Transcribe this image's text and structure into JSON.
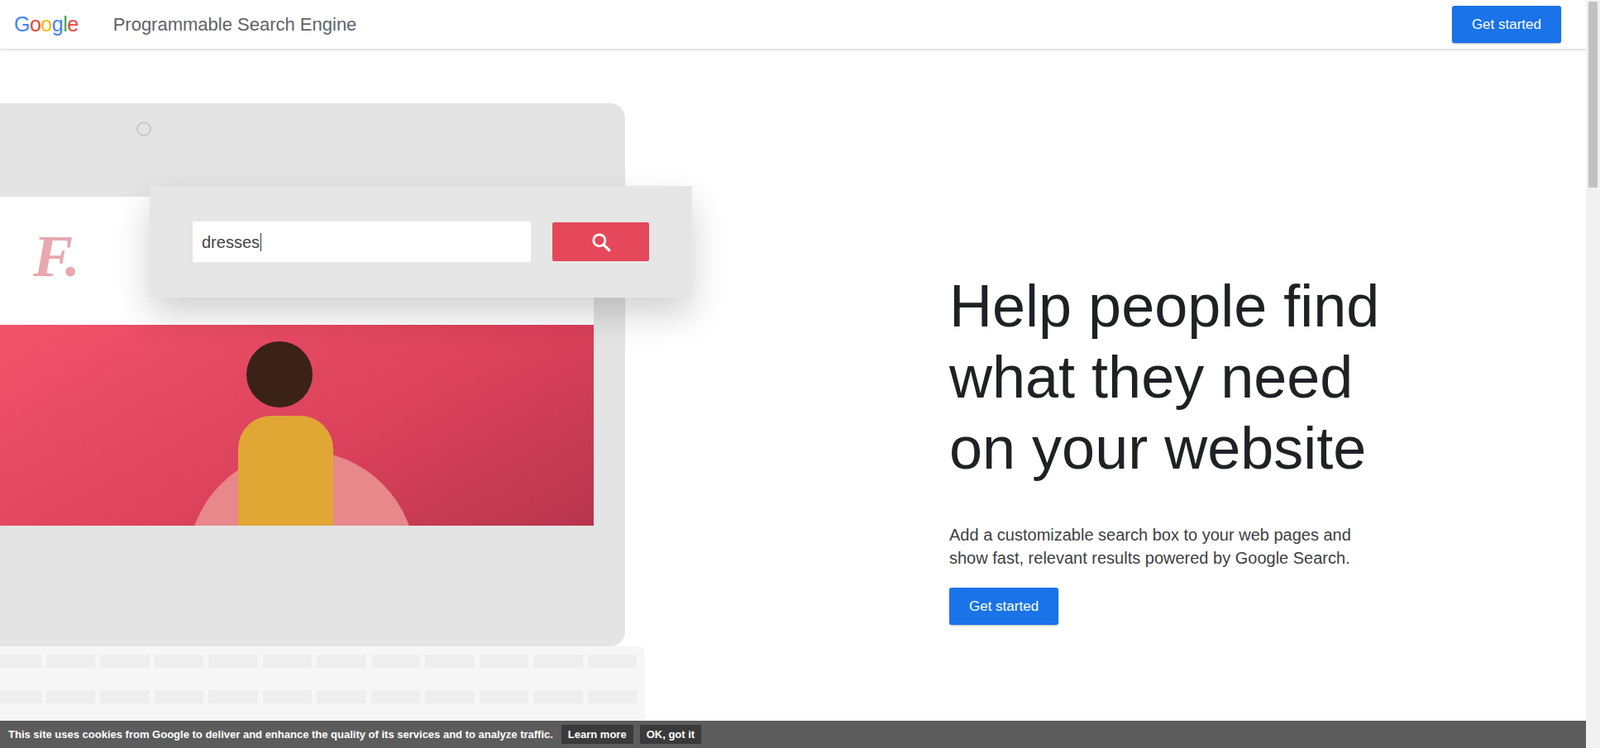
{
  "header": {
    "logo": "Google",
    "title": "Programmable Search Engine",
    "button": "Get started"
  },
  "illustration": {
    "site_logo": "F.",
    "search": {
      "value": "dresses"
    }
  },
  "hero": {
    "heading": [
      "Help people find",
      "what they need",
      "on your website"
    ],
    "description": [
      "Add a customizable search box to your web pages and",
      "show fast, relevant results powered by Google Search."
    ],
    "button": "Get started"
  },
  "cookie_bar": {
    "text": "This site uses cookies from Google to deliver and enhance the quality of its services and to analyze traffic.",
    "buttons": [
      "Learn more",
      "OK, got it"
    ]
  }
}
